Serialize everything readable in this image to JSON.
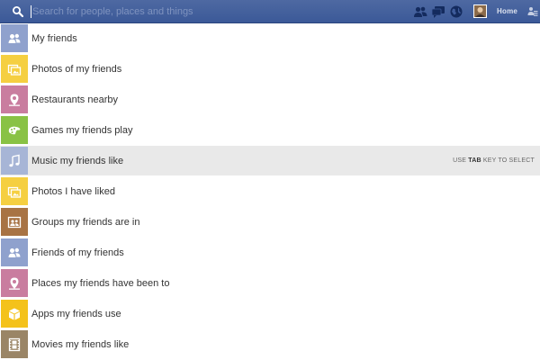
{
  "search": {
    "placeholder": "Search for people, places and things"
  },
  "header": {
    "home_label": "Home",
    "icons": [
      "friend-requests-icon",
      "messages-icon",
      "notifications-globe-icon",
      "profile-avatar",
      "settings-icon"
    ]
  },
  "colors": {
    "topbar": "#3b5998",
    "blue_tile": "#8fa1cd",
    "yellow_tile": "#f5cf41",
    "pink_tile": "#c97d9f",
    "green_tile": "#89c245",
    "brown_tile": "#a87344",
    "gold_tile": "#f4c21b",
    "khaki_tile": "#9a8566",
    "selected_row": "#e9e9e9"
  },
  "results": [
    {
      "label": "My friends",
      "icon": "friends-icon"
    },
    {
      "label": "Photos of my friends",
      "icon": "photos-icon"
    },
    {
      "label": "Restaurants nearby",
      "icon": "place-pin-icon"
    },
    {
      "label": "Games my friends play",
      "icon": "game-controller-icon"
    },
    {
      "label": "Music my friends like",
      "icon": "music-note-icon"
    },
    {
      "label": "Photos I have liked",
      "icon": "photos-icon"
    },
    {
      "label": "Groups my friends are in",
      "icon": "groups-icon"
    },
    {
      "label": "Friends of my friends",
      "icon": "friends-icon"
    },
    {
      "label": "Places my friends have been to",
      "icon": "place-pin-icon"
    },
    {
      "label": "Apps my friends use",
      "icon": "app-cube-icon"
    },
    {
      "label": "Movies my friends like",
      "icon": "film-icon"
    }
  ],
  "selection_hint": {
    "prefix": "USE",
    "key": "TAB",
    "suffix": "KEY TO SELECT"
  }
}
